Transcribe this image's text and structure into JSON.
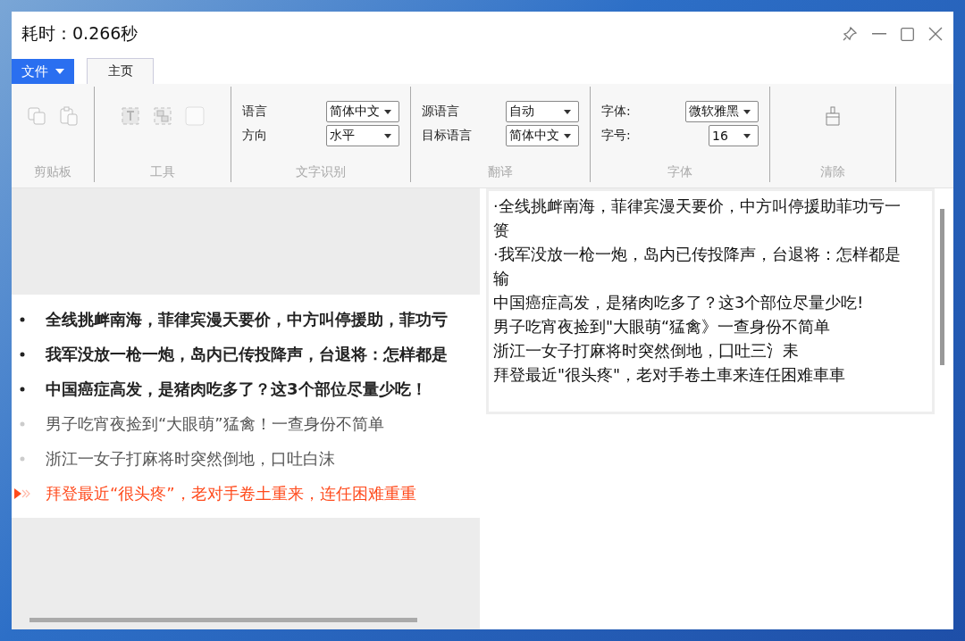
{
  "window": {
    "title": "耗时：0.266秒"
  },
  "file_menu": {
    "label": "文件"
  },
  "tabs": [
    {
      "label": "主页",
      "selected": true
    }
  ],
  "ribbon": {
    "groups": [
      {
        "kind": "icons",
        "label": "剪贴板",
        "icons": [
          {
            "kind": "copy",
            "disabled": true
          },
          {
            "kind": "paste",
            "disabled": true
          }
        ]
      },
      {
        "kind": "icons",
        "label": "工具",
        "icons": [
          {
            "kind": "text-frame",
            "disabled": true
          },
          {
            "kind": "image-text",
            "disabled": true
          },
          {
            "kind": "blank",
            "disabled": true
          }
        ]
      },
      {
        "kind": "fields",
        "label": "文字识别",
        "fields": [
          {
            "label": "语言",
            "value": "简体中文"
          },
          {
            "label": "方向",
            "value": "水平"
          }
        ]
      },
      {
        "kind": "fields",
        "label": "翻译",
        "fields": [
          {
            "label": "源语言",
            "value": "自动"
          },
          {
            "label": "目标语言",
            "value": "简体中文"
          }
        ]
      },
      {
        "kind": "fields",
        "label": "字体",
        "fields": [
          {
            "label": "字体:",
            "value": "微软雅黑"
          },
          {
            "label": "字号:",
            "value": "16"
          }
        ]
      },
      {
        "kind": "icons",
        "label": "清除",
        "icons": [
          {
            "kind": "brush",
            "disabled": false
          }
        ]
      }
    ]
  },
  "source_list": [
    {
      "kind": "bold",
      "text": "全线挑衅南海，菲律宾漫天要价，中方叫停援助，菲功亏"
    },
    {
      "kind": "bold",
      "text": "我军没放一枪一炮，岛内已传投降声，台退将：怎样都是"
    },
    {
      "kind": "bold",
      "text": "中国癌症高发，是猪肉吃多了？这3个部位尽量少吃！"
    },
    {
      "kind": "plain",
      "text": "男子吃宵夜捡到“大眼萌”猛禽！一查身份不简单"
    },
    {
      "kind": "plain",
      "text": "浙江一女子打麻将时突然倒地，口吐白沫"
    },
    {
      "kind": "current",
      "text": "拜登最近“很头疼”，老对手卷土重来，连任困难重重"
    }
  ],
  "result_lines": [
    "·全线挑衅南海，菲律宾漫天要价，中方叫停援助菲功亏一篑",
    "·我军没放一枪一炮，岛内已传投降声，台退将：怎样都是输",
    "中国癌症高发，是猪肉吃多了？这3个部位尽量少吃!",
    "男子吃宵夜捡到\"大眼萌“猛禽》一查身份不简单",
    "浙江一女子打麻将时突然倒地，囗吐三氵耒",
    "拜登最近\"很头疼\"，老对手卷土車来连任困难車車"
  ]
}
